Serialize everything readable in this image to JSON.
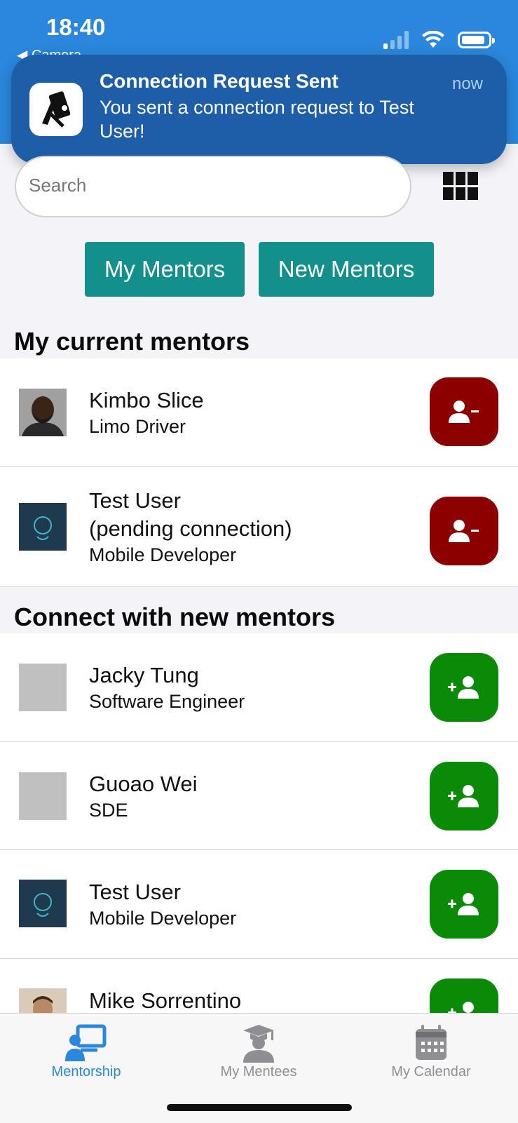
{
  "status_bar": {
    "time": "18:40",
    "back_label": "◀ Camera"
  },
  "notification": {
    "title": "Connection Request Sent",
    "body": "You sent a connection request to Test User!",
    "time": "now"
  },
  "search": {
    "placeholder": "Search",
    "value": ""
  },
  "segments": {
    "my_mentors": "My Mentors",
    "new_mentors": "New Mentors"
  },
  "sections": {
    "current": {
      "title": "My current mentors",
      "items": [
        {
          "name": "Kimbo Slice",
          "status": "",
          "role": "Limo Driver",
          "avatar": "photo"
        },
        {
          "name": "Test User",
          "status": "(pending connection)",
          "role": "Mobile Developer",
          "avatar": "logo"
        }
      ]
    },
    "new": {
      "title": "Connect with new mentors",
      "items": [
        {
          "name": "Jacky Tung",
          "role": "Software Engineer",
          "avatar": "placeholder"
        },
        {
          "name": "Guoao Wei",
          "role": "SDE",
          "avatar": "placeholder"
        },
        {
          "name": "Test User",
          "role": "Mobile Developer",
          "avatar": "logo"
        },
        {
          "name": "Mike Sorrentino",
          "role": "",
          "avatar": "photo"
        }
      ]
    }
  },
  "tabs": [
    {
      "label": "Mentorship",
      "icon": "mentorship-icon",
      "active": true
    },
    {
      "label": "My Mentees",
      "icon": "graduate-icon",
      "active": false
    },
    {
      "label": "My Calendar",
      "icon": "calendar-icon",
      "active": false
    }
  ],
  "colors": {
    "header": "#2a87dc",
    "segment": "#138f8c",
    "remove": "#8c0000",
    "add": "#0b8a08",
    "active_tab": "#2a87dc"
  }
}
